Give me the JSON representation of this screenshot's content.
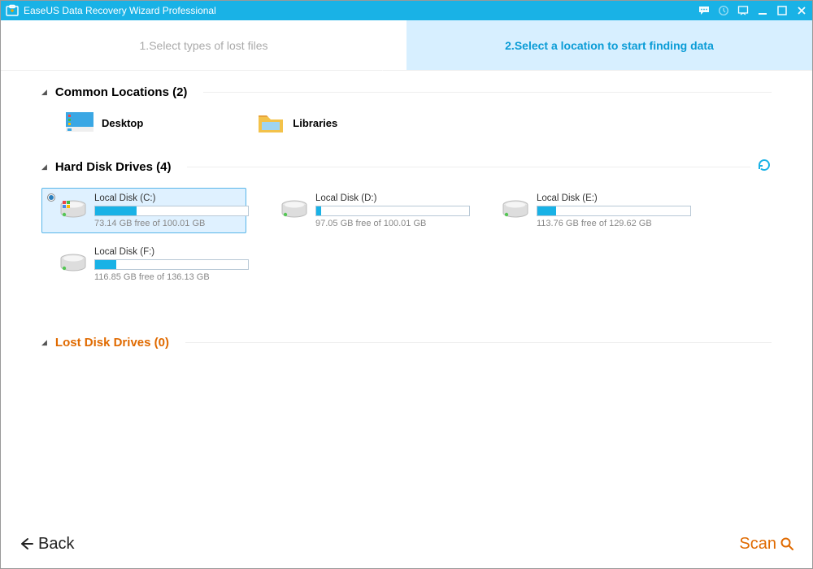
{
  "app": {
    "title": "EaseUS Data Recovery Wizard Professional"
  },
  "steps": {
    "step1": "1.Select types of lost files",
    "step2": "2.Select a location to start finding data"
  },
  "sections": {
    "common_title": "Common Locations (2)",
    "drives_title": "Hard Disk Drives (4)",
    "lost_title": "Lost Disk Drives (0)"
  },
  "common": {
    "desktop": "Desktop",
    "libraries": "Libraries"
  },
  "drives": [
    {
      "name": "Local Disk (C:)",
      "free": "73.14 GB free of 100.01 GB",
      "used_pct": 27,
      "selected": true
    },
    {
      "name": "Local Disk (D:)",
      "free": "97.05 GB free of 100.01 GB",
      "used_pct": 3,
      "selected": false
    },
    {
      "name": "Local Disk (E:)",
      "free": "113.76 GB free of 129.62 GB",
      "used_pct": 12,
      "selected": false
    },
    {
      "name": "Local Disk (F:)",
      "free": "116.85 GB free of 136.13 GB",
      "used_pct": 14,
      "selected": false
    }
  ],
  "footer": {
    "back": "Back",
    "scan": "Scan"
  }
}
